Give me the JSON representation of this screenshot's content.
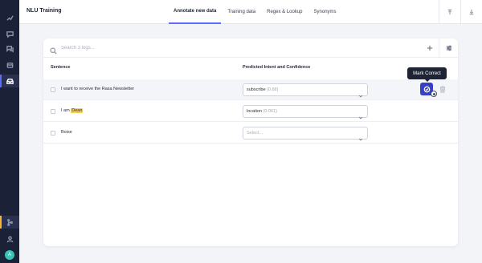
{
  "app": {
    "title": "NLU Training"
  },
  "tabs": [
    {
      "label": "Annotate new data",
      "active": true
    },
    {
      "label": "Training data",
      "active": false
    },
    {
      "label": "Regex & Lookup",
      "active": false
    },
    {
      "label": "Synonyms",
      "active": false
    }
  ],
  "search": {
    "placeholder": "Search 3 logs..."
  },
  "columns": {
    "sentence": "Sentence",
    "intent": "Predicted Intent and Confidence"
  },
  "rows": [
    {
      "pre": "I want to receive the Rasa Newsletter",
      "entity": "",
      "intent": "subscribe",
      "confidence": "(0.68)"
    },
    {
      "pre": "I am ",
      "entity": "Dean",
      "intent": "location",
      "confidence": "(0.061)"
    },
    {
      "pre": "Boise",
      "entity": "",
      "intent": "",
      "confidence": "",
      "placeholder": "Select..."
    }
  ],
  "tooltip": {
    "text": "Mark Correct"
  },
  "user": {
    "initial": "A"
  },
  "colors": {
    "accent": "#5b6cff",
    "sidebar": "#1b2136",
    "mark_button": "#3640c8",
    "entity_highlight": "#f2d256",
    "git_indicator": "#f5b53a"
  }
}
